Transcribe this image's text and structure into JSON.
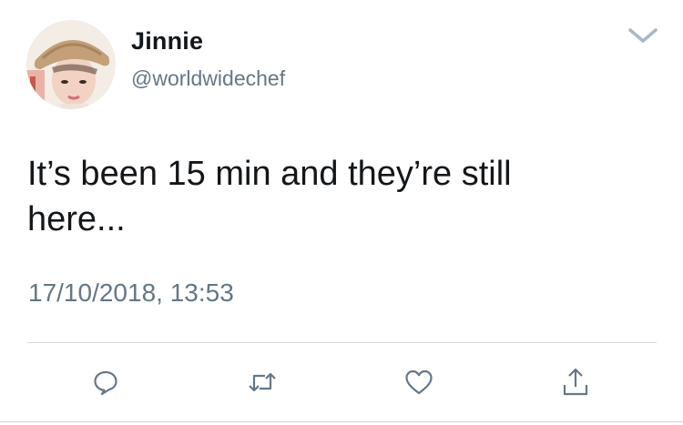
{
  "user": {
    "display_name": "Jinnie",
    "handle": "@worldwidechef"
  },
  "tweet": {
    "text": "It’s been 15 min and they’re still here...",
    "timestamp": "17/10/2018, 13:53"
  },
  "icons": {
    "menu": "chevron-down-icon",
    "reply": "speech-bubble-icon",
    "retweet": "retweet-icon",
    "like": "heart-icon",
    "share": "share-icon"
  },
  "colors": {
    "text": "#14171a",
    "secondary": "#657786",
    "icon": "#657786",
    "divider": "#d6dadd"
  }
}
